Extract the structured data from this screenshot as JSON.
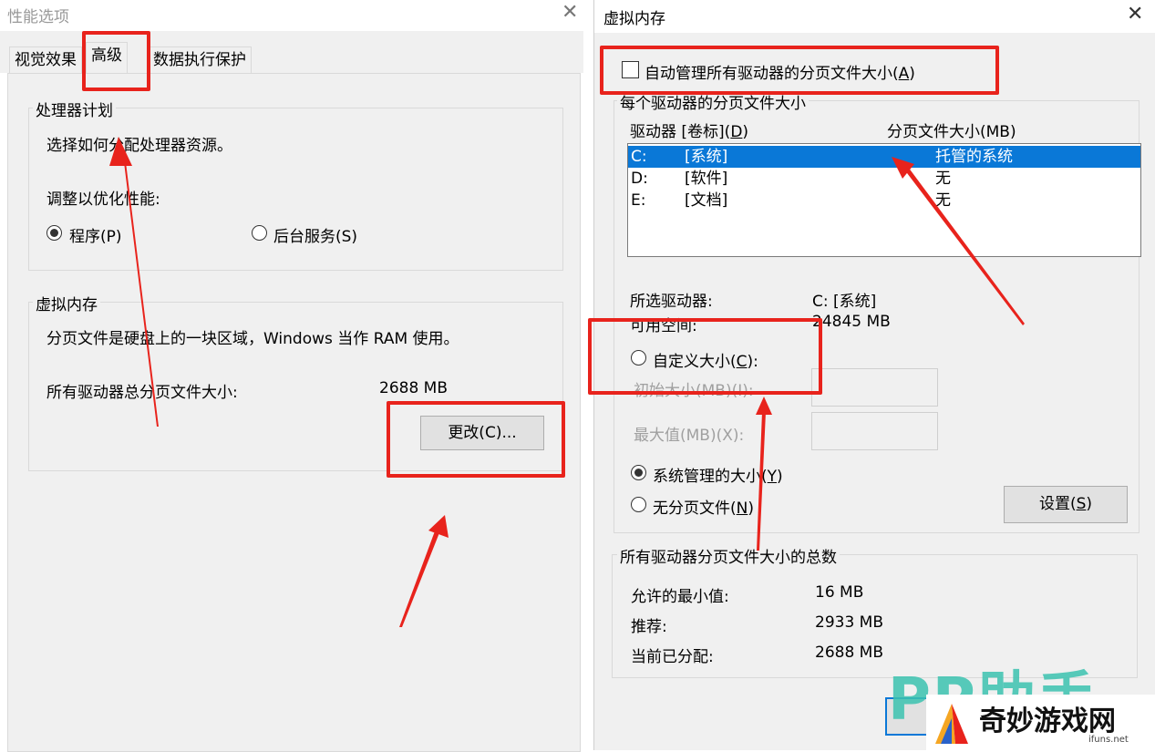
{
  "perf_dialog": {
    "title": "性能选项",
    "tabs": [
      "视觉效果",
      "高级",
      "数据执行保护"
    ],
    "processor_group": {
      "legend": "处理器计划",
      "desc": "选择如何分配处理器资源。",
      "adjust_label": "调整以优化性能:",
      "radio_program": "程序(P)",
      "radio_service": "后台服务(S)"
    },
    "vm_group": {
      "legend": "虚拟内存",
      "desc": "分页文件是硬盘上的一块区域，Windows 当作 RAM 使用。",
      "total_label": "所有驱动器总分页文件大小:",
      "total_value": "2688 MB",
      "change_button": "更改(C)..."
    }
  },
  "vm_dialog": {
    "title": "虚拟内存",
    "auto_manage": {
      "prefix": "自动管理所有驱动器的分页文件大小(",
      "key": "A",
      "suffix": ")"
    },
    "per_drive_legend": "每个驱动器的分页文件大小",
    "col_drive": {
      "prefix": "驱动器 [卷标](",
      "key": "D",
      "suffix": ")"
    },
    "col_size": "分页文件大小(MB)",
    "drives": [
      {
        "letter": "C:",
        "label": "[系统]",
        "size": "托管的系统"
      },
      {
        "letter": "D:",
        "label": "[软件]",
        "size": "无"
      },
      {
        "letter": "E:",
        "label": "[文档]",
        "size": "无"
      }
    ],
    "selected_drive_label": "所选驱动器:",
    "selected_drive_value": "C:  [系统]",
    "free_space_label": "可用空间:",
    "free_space_value": "24845 MB",
    "custom_size": {
      "prefix": "自定义大小(",
      "key": "C",
      "suffix": "):"
    },
    "initial_size_label": "初始大小(MB)(I):",
    "max_size_label": "最大值(MB)(X):",
    "system_managed": {
      "prefix": "系统管理的大小(",
      "key": "Y",
      "suffix": ")"
    },
    "no_paging": {
      "prefix": "无分页文件(",
      "key": "N",
      "suffix": ")"
    },
    "set_button": {
      "prefix": "设置(",
      "key": "S",
      "suffix": ")"
    },
    "totals_legend": "所有驱动器分页文件大小的总数",
    "min_allowed_label": "允许的最小值:",
    "min_allowed_value": "16 MB",
    "recommended_label": "推荐:",
    "recommended_value": "2933 MB",
    "current_label": "当前已分配:",
    "current_value": "2688 MB"
  },
  "watermark": {
    "pp_text": "PP助手",
    "site_name": "奇妙游戏网",
    "site_url": "ifuns.net"
  },
  "colors": {
    "annotation": "#e8231c",
    "selection": "#0a78d7",
    "pp_teal": "#3cc3b0"
  }
}
